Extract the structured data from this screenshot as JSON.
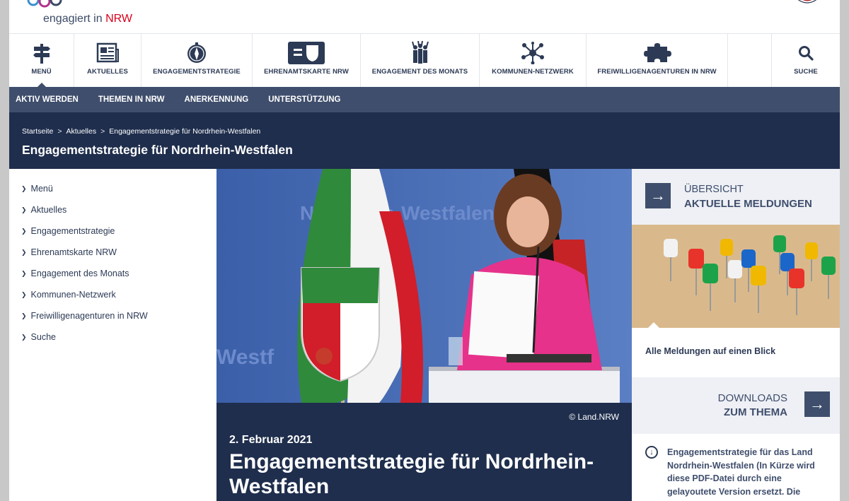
{
  "header": {
    "logo_text": "engagiert in ",
    "logo_highlight": "NRW"
  },
  "mainnav": [
    {
      "label": "MENÜ",
      "icon": "signpost-icon"
    },
    {
      "label": "AKTUELLES",
      "icon": "newspaper-icon"
    },
    {
      "label": "ENGAGEMENTSTRATEGIE",
      "icon": "compass-icon"
    },
    {
      "label": "EHRENAMTSKARTE NRW",
      "icon": "card-icon"
    },
    {
      "label": "ENGAGEMENT DES MONATS",
      "icon": "people-cheer-icon"
    },
    {
      "label": "KOMMUNEN-NETZWERK",
      "icon": "network-icon"
    },
    {
      "label": "FREIWILLIGENAGENTUREN IN NRW",
      "icon": "puzzle-icon"
    },
    {
      "label": "SUCHE",
      "icon": "search-icon"
    }
  ],
  "subnav": [
    "AKTIV WERDEN",
    "THEMEN IN NRW",
    "ANERKENNUNG",
    "UNTERSTÜTZUNG"
  ],
  "breadcrumb": {
    "items": [
      "Startseite",
      "Aktuelles",
      "Engagementstrategie für Nordrhein-Westfalen"
    ],
    "sep": ">"
  },
  "page_title": "Engagementstrategie für Nordrhein-Westfalen",
  "sidebar": [
    "Menü",
    "Aktuelles",
    "Engagementstrategie",
    "Ehrenamtskarte NRW",
    "Engagement des Monats",
    "Kommunen-Netzwerk",
    "Freiwilligenagenturen in NRW",
    "Suche"
  ],
  "article": {
    "copyright": "© Land.NRW",
    "date": "2. Februar 2021",
    "title": "Engagementstrategie für Nordrhein-Westfalen",
    "backdrop_text": "Nordrhein-Westfalen"
  },
  "right": {
    "overview_line1": "ÜBERSICHT",
    "overview_line2": "AKTUELLE MELDUNGEN",
    "all_news": "Alle Meldungen auf einen Blick",
    "downloads_line1": "DOWNLOADS",
    "downloads_line2": "ZUM THEMA",
    "download_item": "Engagementstrategie für das Land Nordrhein-Westfalen (In Kürze wird diese PDF-Datei durch eine gelayoutete Version ersetzt. Die"
  },
  "colors": {
    "navy": "#1f2e4d",
    "slate": "#3f4e6c",
    "nrw_red": "#d7001a"
  }
}
